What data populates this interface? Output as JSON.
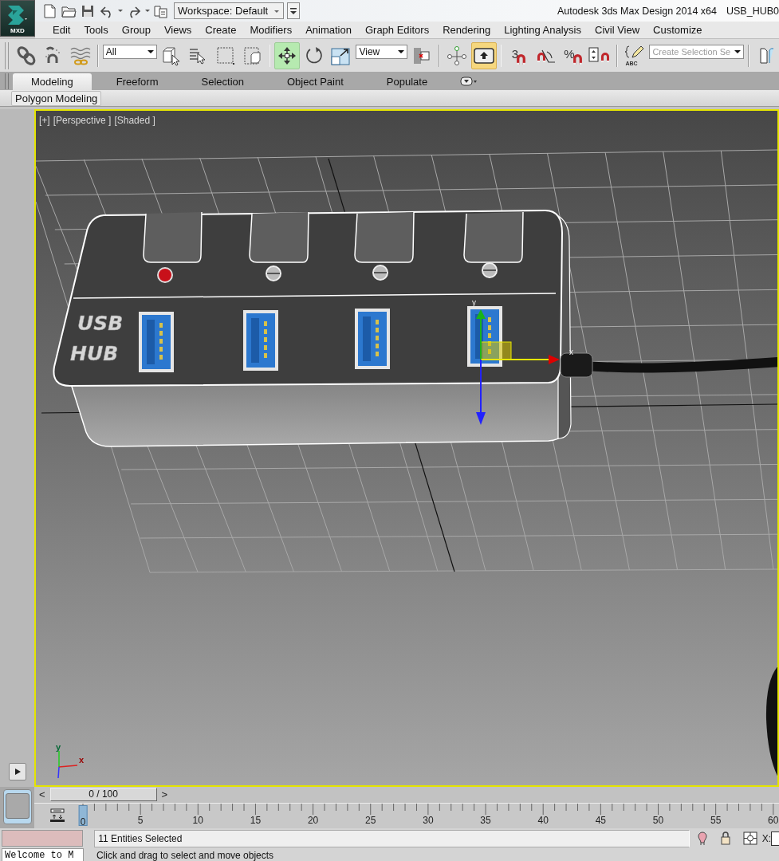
{
  "app": {
    "logo": "MXD",
    "title": "Autodesk 3ds Max Design 2014 x64",
    "file": "USB_HUB0"
  },
  "quick_access": {
    "workspace": "Workspace: Default"
  },
  "menu": [
    "Edit",
    "Tools",
    "Group",
    "Views",
    "Create",
    "Modifiers",
    "Animation",
    "Graph Editors",
    "Rendering",
    "Lighting Analysis",
    "Civil View",
    "Customize"
  ],
  "toolbar": {
    "selection_filter": "All",
    "move_active": true,
    "coordinate_system": "View",
    "shortcut_override": true,
    "snap_label": "3",
    "percent_snap_label": "%",
    "named_sets_label": "ABC",
    "named_selection_placeholder": "Create Selection Se"
  },
  "ribbon": {
    "tabs": [
      {
        "label": "Modeling",
        "selected": true
      },
      {
        "label": "Freeform",
        "selected": false
      },
      {
        "label": "Selection",
        "selected": false
      },
      {
        "label": "Object Paint",
        "selected": false
      },
      {
        "label": "Populate",
        "selected": false
      }
    ],
    "panel": "Polygon Modeling"
  },
  "viewport": {
    "labels": [
      "[+]",
      "[Perspective ]",
      "[Shaded ]"
    ],
    "model_text": [
      "USB",
      "HUB"
    ],
    "gizmo_axes": [
      "y",
      "x"
    ],
    "tripod_axes": [
      "y",
      "x"
    ]
  },
  "timeline": {
    "prev": "<",
    "frame": "0 / 100",
    "next": ">",
    "ruler": [
      {
        "label": "0",
        "selected": true
      },
      {
        "label": "5",
        "selected": false
      },
      {
        "label": "10",
        "selected": false
      },
      {
        "label": "15",
        "selected": false
      },
      {
        "label": "20",
        "selected": false
      },
      {
        "label": "25",
        "selected": false
      },
      {
        "label": "30",
        "selected": false
      },
      {
        "label": "35",
        "selected": false
      },
      {
        "label": "40",
        "selected": false
      },
      {
        "label": "45",
        "selected": false
      },
      {
        "label": "50",
        "selected": false
      },
      {
        "label": "55",
        "selected": false
      },
      {
        "label": "60",
        "selected": false
      }
    ]
  },
  "status": {
    "listener": "Welcome to M",
    "selection": "11 Entities Selected",
    "coord_label": "X:",
    "prompt": "Click and drag to select and move objects"
  }
}
